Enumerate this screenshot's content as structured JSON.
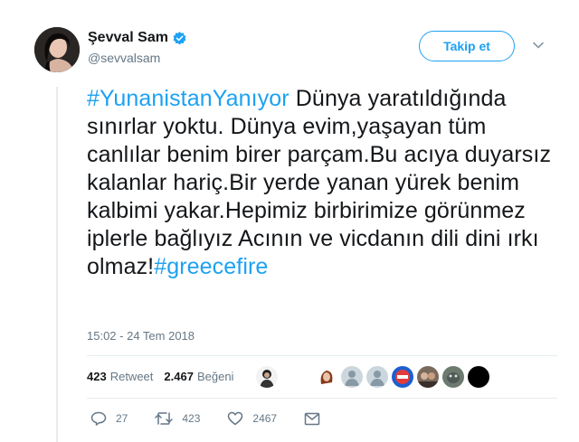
{
  "user": {
    "display_name": "Şevval Sam",
    "handle": "@sevvalsam",
    "verified_icon": "verified-badge-icon"
  },
  "follow_button": {
    "label": "Takip et"
  },
  "tweet": {
    "hashtag_1": "#YunanistanYanıyor",
    "body": " Dünya yaratıldığında sınırlar yoktu. Dünya evim,yaşayan tüm canlılar benim birer parçam.Bu acıya duyarsız kalanlar hariç.Bir yerde yanan yürek benim kalbimi yakar.Hepimiz birbirimize görünmez iplerle bağlıyız Acının ve vicdanın dili dini ırkı olmaz!",
    "hashtag_2": "#greecefire"
  },
  "timestamp": "15:02 - 24 Tem 2018",
  "stats": {
    "retweet_count": "423",
    "retweet_label": "Retweet",
    "like_count": "2.467",
    "like_label": "Beğeni"
  },
  "actions": {
    "reply_count": "27",
    "retweet_count": "423",
    "like_count": "2467"
  },
  "colors": {
    "accent": "#1da1f2",
    "secondary_text": "#657786",
    "primary_text": "#14171a"
  }
}
